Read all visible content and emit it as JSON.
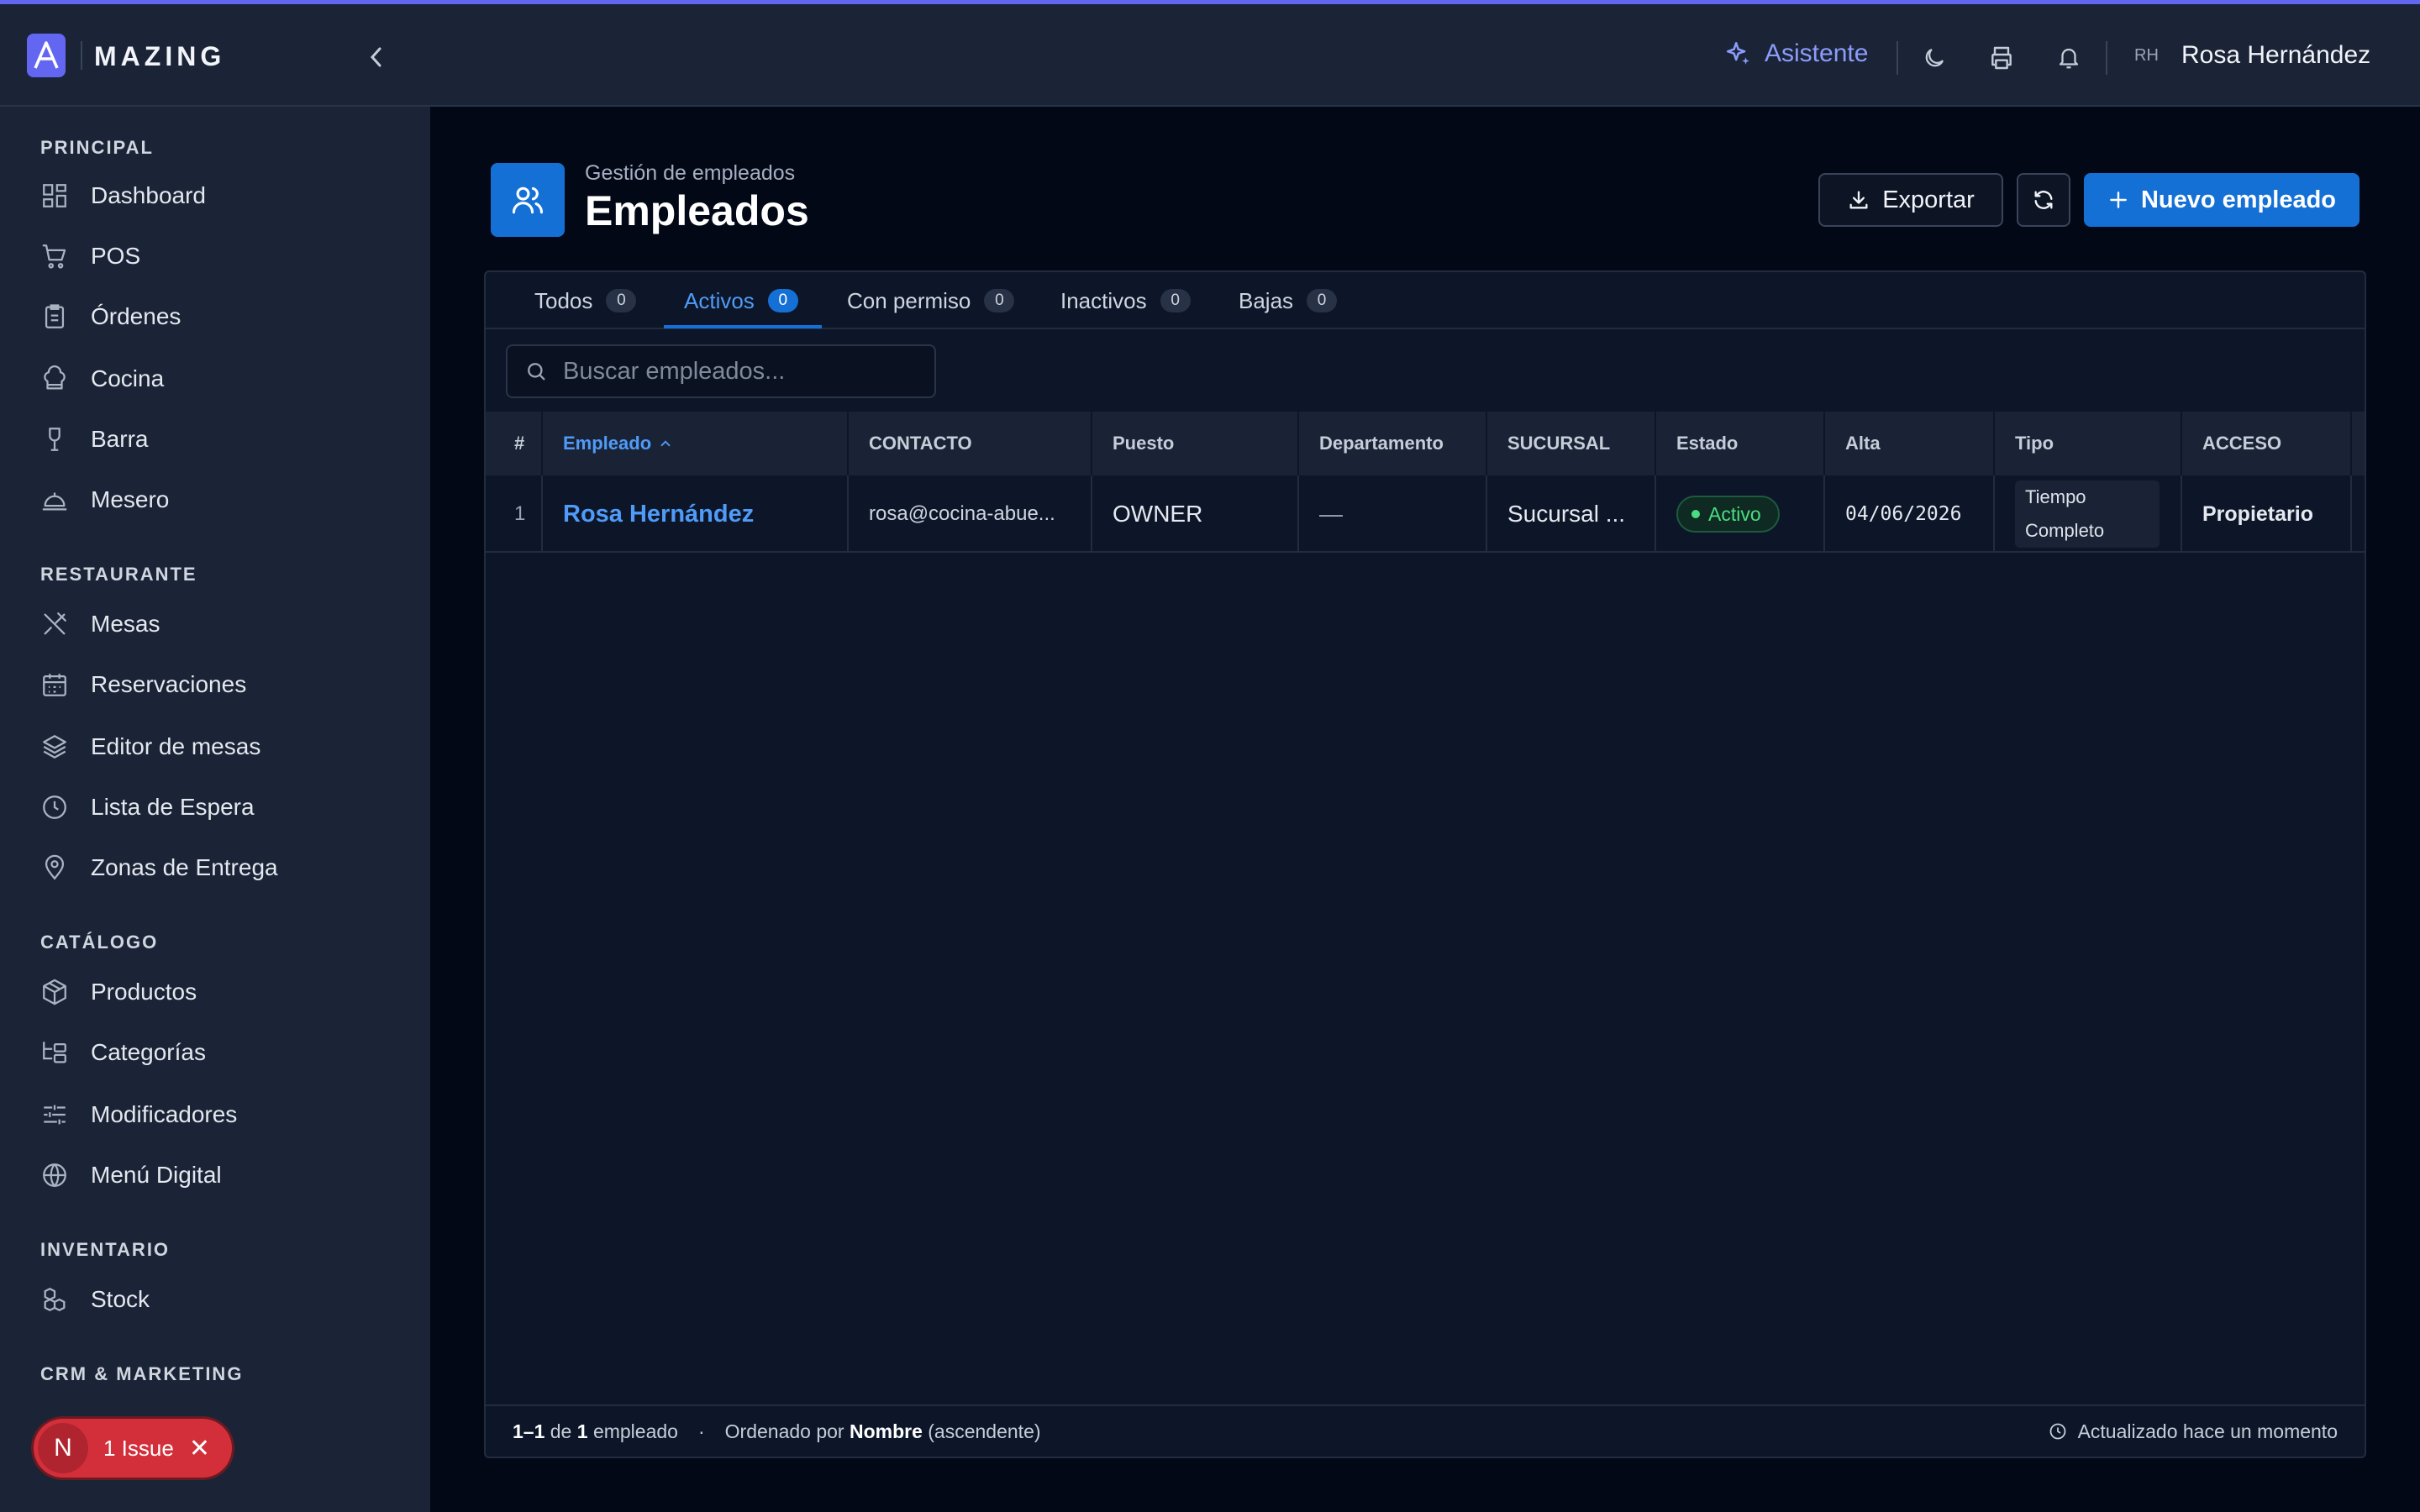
{
  "app": {
    "logo_letter": "A",
    "logo_text": "MAZING"
  },
  "topbar": {
    "assistant_label": "Asistente",
    "user_initials": "RH",
    "user_name": "Rosa Hernández"
  },
  "sidebar": {
    "sections": [
      {
        "title": "PRINCIPAL",
        "items": [
          {
            "label": "Dashboard",
            "icon": "dashboard-icon"
          },
          {
            "label": "POS",
            "icon": "cart-icon"
          },
          {
            "label": "Órdenes",
            "icon": "clipboard-icon"
          },
          {
            "label": "Cocina",
            "icon": "chef-hat-icon"
          },
          {
            "label": "Barra",
            "icon": "wine-glass-icon"
          },
          {
            "label": "Mesero",
            "icon": "cloche-icon"
          }
        ]
      },
      {
        "title": "RESTAURANTE",
        "items": [
          {
            "label": "Mesas",
            "icon": "utensils-icon"
          },
          {
            "label": "Reservaciones",
            "icon": "calendar-icon"
          },
          {
            "label": "Editor de mesas",
            "icon": "layers-icon"
          },
          {
            "label": "Lista de Espera",
            "icon": "clock-icon"
          },
          {
            "label": "Zonas de Entrega",
            "icon": "map-pin-icon"
          }
        ]
      },
      {
        "title": "CATÁLOGO",
        "items": [
          {
            "label": "Productos",
            "icon": "package-icon"
          },
          {
            "label": "Categorías",
            "icon": "folder-tree-icon"
          },
          {
            "label": "Modificadores",
            "icon": "sliders-icon"
          },
          {
            "label": "Menú Digital",
            "icon": "globe-icon"
          }
        ]
      },
      {
        "title": "INVENTARIO",
        "items": [
          {
            "label": "Stock",
            "icon": "boxes-icon"
          }
        ]
      },
      {
        "title": "CRM & MARKETING",
        "items": []
      }
    ]
  },
  "issues": {
    "badge_letter": "N",
    "label": "1 Issue"
  },
  "page": {
    "subtitle": "Gestión de empleados",
    "title": "Empleados",
    "export_label": "Exportar",
    "new_label": "Nuevo empleado"
  },
  "tabs": [
    {
      "label": "Todos",
      "count": "0"
    },
    {
      "label": "Activos",
      "count": "0"
    },
    {
      "label": "Con permiso",
      "count": "0"
    },
    {
      "label": "Inactivos",
      "count": "0"
    },
    {
      "label": "Bajas",
      "count": "0"
    }
  ],
  "active_tab": "Activos",
  "search": {
    "placeholder": "Buscar empleados..."
  },
  "table": {
    "columns": [
      "#",
      "Empleado",
      "CONTACTO",
      "Puesto",
      "Departamento",
      "SUCURSAL",
      "Estado",
      "Alta",
      "Tipo",
      "ACCESO"
    ],
    "rows": [
      {
        "num": "1",
        "empleado": "Rosa Hernández",
        "contacto": "rosa@cocina-abue...",
        "puesto": "OWNER",
        "departamento": "—",
        "sucursal": "Sucursal ...",
        "estado": "Activo",
        "alta": "04/06/2026",
        "tipo": "Tiempo Completo",
        "acceso": "Propietario"
      }
    ]
  },
  "footer": {
    "range": "1–1",
    "of": "de",
    "total": "1",
    "unit": "empleado",
    "sep": "·",
    "sorted_by": "Ordenado por",
    "sort_field": "Nombre",
    "sort_dir": "(ascendente)",
    "updated": "Actualizado hace un momento"
  },
  "colors": {
    "accent": "#6366f1",
    "primary": "#1570d6",
    "success": "#4ade80",
    "danger": "#d32f3a"
  }
}
